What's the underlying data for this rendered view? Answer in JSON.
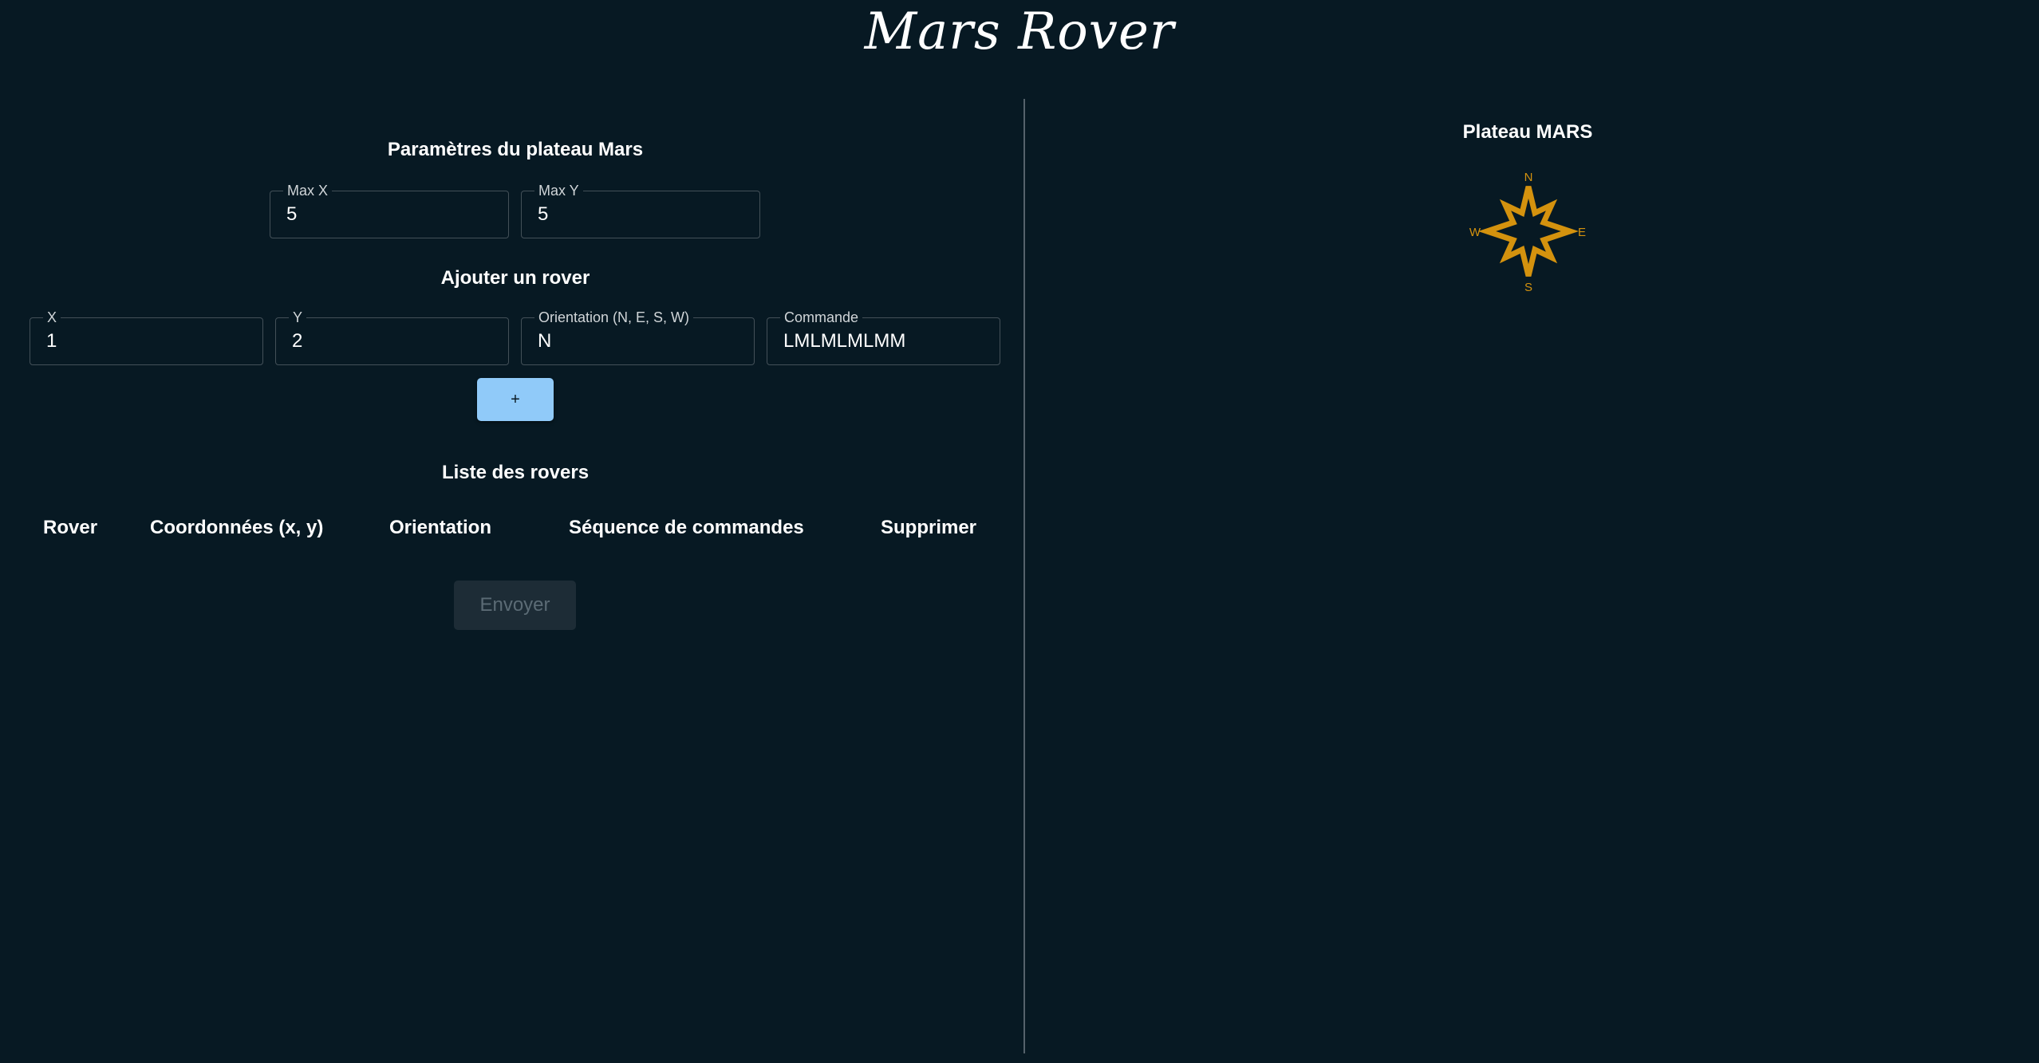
{
  "app": {
    "title": "Mars Rover"
  },
  "plateau_params": {
    "title": "Paramètres du plateau Mars",
    "max_x": {
      "label": "Max X",
      "value": "5"
    },
    "max_y": {
      "label": "Max Y",
      "value": "5"
    }
  },
  "add_rover": {
    "title": "Ajouter un rover",
    "x": {
      "label": "X",
      "value": "1"
    },
    "y": {
      "label": "Y",
      "value": "2"
    },
    "orientation": {
      "label": "Orientation (N, E, S, W)",
      "value": "N"
    },
    "command": {
      "label": "Commande",
      "value": "LMLMLMLMM"
    },
    "add_label": "+"
  },
  "rover_list": {
    "title": "Liste des rovers",
    "columns": [
      "Rover",
      "Coordonnées (x, y)",
      "Orientation",
      "Séquence de commandes",
      "Supprimer"
    ],
    "rows": [],
    "send_label": "Envoyer"
  },
  "plateau_view": {
    "title": "Plateau MARS",
    "compass": {
      "icon": "compass-rose-icon",
      "color": "#d4920e",
      "n": "N",
      "e": "E",
      "s": "S",
      "w": "W"
    }
  },
  "colors": {
    "background": "#071923",
    "accent": "#90caf9",
    "compass": "#d4920e"
  }
}
